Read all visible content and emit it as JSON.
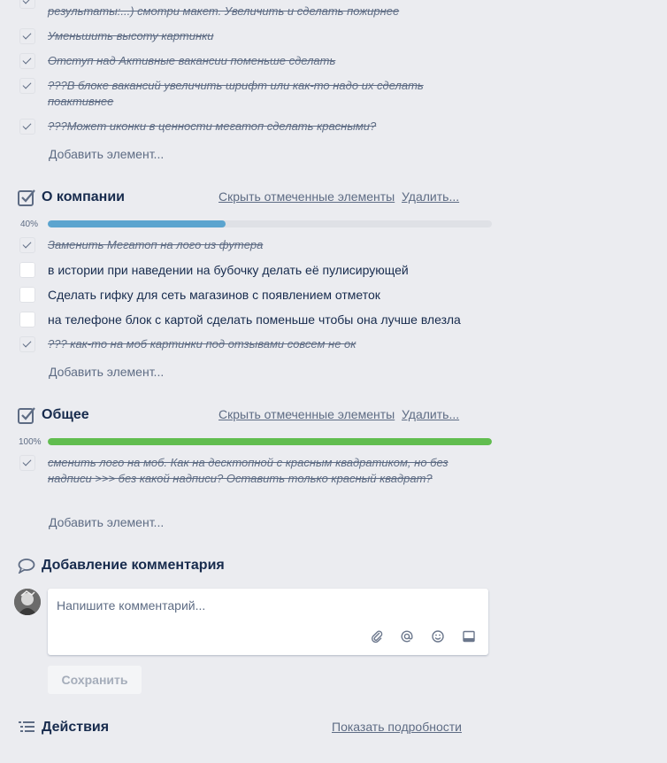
{
  "top_items": [
    {
      "text": "результаты:...) смотри макет. Увеличить и сделать пожирнее",
      "checked": true
    },
    {
      "text": "Уменьшить высоту картинки",
      "checked": true
    },
    {
      "text": "Отступ над Активные вакансии поменьше сделать",
      "checked": true
    },
    {
      "text": "???В блоке вакансий увеличить шрифт или как-то надо их сделать поактивнее",
      "checked": true
    },
    {
      "text": "???Может иконки в ценности мегатоп сделать красными?",
      "checked": true
    }
  ],
  "add_item_label": "Добавить элемент...",
  "checklists": [
    {
      "title": "О компании",
      "hide_label": "Скрыть отмеченные элементы",
      "delete_label": "Удалить...",
      "percent_label": "40%",
      "progress": 0.4,
      "items": [
        {
          "text": "Заменить Мегатоп на лого из футера",
          "checked": true
        },
        {
          "text": "в истории при наведении на бубочку делать её пулисирующей",
          "checked": false
        },
        {
          "text": "Сделать гифку для сеть магазинов с появлением отметок",
          "checked": false
        },
        {
          "text": "на телефоне блок с картой сделать поменьше чтобы она лучше влезла",
          "checked": false
        },
        {
          "text": "??? как-то на моб картинки под отзывами совсем не ок",
          "checked": true
        }
      ]
    },
    {
      "title": "Общее",
      "hide_label": "Скрыть отмеченные элементы",
      "delete_label": "Удалить...",
      "percent_label": "100%",
      "progress": 1.0,
      "items": [
        {
          "text": "сменить лого на моб. Как на десктопной с красным квадратиком, но без надписи >>> без какой надписи? Оставить только красный квадрат?",
          "checked": true
        }
      ]
    }
  ],
  "comment": {
    "title": "Добавление комментария",
    "placeholder": "Напишите комментарий...",
    "save_label": "Сохранить",
    "icons": [
      "paperclip-icon",
      "mention-icon",
      "emoji-icon",
      "card-icon"
    ]
  },
  "activity": {
    "title": "Действия",
    "details_label": "Показать подробности"
  },
  "colors": {
    "progress_partial": "#5ba4cf",
    "progress_complete": "#61bd4f",
    "background": "#ebecf0"
  }
}
